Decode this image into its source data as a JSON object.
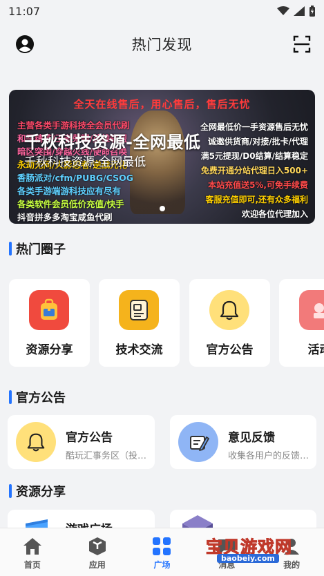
{
  "status": {
    "time": "11:07"
  },
  "header": {
    "title": "热门发现"
  },
  "banner": {
    "top_line": "全天在线售后，用心售后，售后无忧",
    "left_lines": [
      "主营各类手游科技全会员代刷",
      "和平精英/王者荣耀/英雄联盟",
      "暗区突围/穿越火线/使命召唤",
      "永劫无间/火影忍者/逆战元化",
      "香肠派对/cfm/PUBG/CSOG",
      "各类手游端游科技应有尽有",
      "各类软件会员低价充值/快手",
      "抖音拼多多淘宝咸鱼代刷"
    ],
    "right_lines": [
      "全网最低价一手资源售后无忧",
      "诚邀供货商/对接/批卡/代理",
      "满5元提现/D0结算/结算稳定",
      "免费开通分站代理日入500+",
      "本站充值送5%,可免手续费",
      "客服充值即可,还有众多福利",
      "欢迎各位代理加入"
    ],
    "overlay_title": "千秋科技资源-全网最低",
    "overlay_subtitle": "千秋科技资源-全网最低"
  },
  "sections": {
    "hot_circles": "热门圈子",
    "announcements": "官方公告",
    "resources": "资源分享"
  },
  "circles": [
    {
      "label": "资源分享",
      "icon": "backpack-icon",
      "bg": "#f04a3e"
    },
    {
      "label": "技术交流",
      "icon": "document-icon",
      "bg": "#f5b31c"
    },
    {
      "label": "官方公告",
      "icon": "bell-icon",
      "bg": "#ffe07a"
    },
    {
      "label": "活动",
      "icon": "gift-icon",
      "bg": "#f27a7a"
    }
  ],
  "announcements": [
    {
      "title": "官方公告",
      "subtitle": "酷玩汇事务区（投…",
      "icon": "bell-icon"
    },
    {
      "title": "意见反馈",
      "subtitle": "收集各用户的反馈…",
      "icon": "feedback-icon"
    }
  ],
  "resources": [
    {
      "title": "游戏广场"
    },
    {
      "title": ""
    }
  ],
  "nav": [
    {
      "label": "首页",
      "icon": "home-icon"
    },
    {
      "label": "应用",
      "icon": "cube-icon"
    },
    {
      "label": "广场",
      "icon": "grid-icon",
      "active": true
    },
    {
      "label": "消息",
      "icon": "message-icon"
    },
    {
      "label": "我的",
      "icon": "user-icon"
    }
  ],
  "watermark": {
    "text": "宝贝游戏网",
    "url": "baobeiy.com"
  },
  "colors": {
    "accent": "#2474ff"
  }
}
